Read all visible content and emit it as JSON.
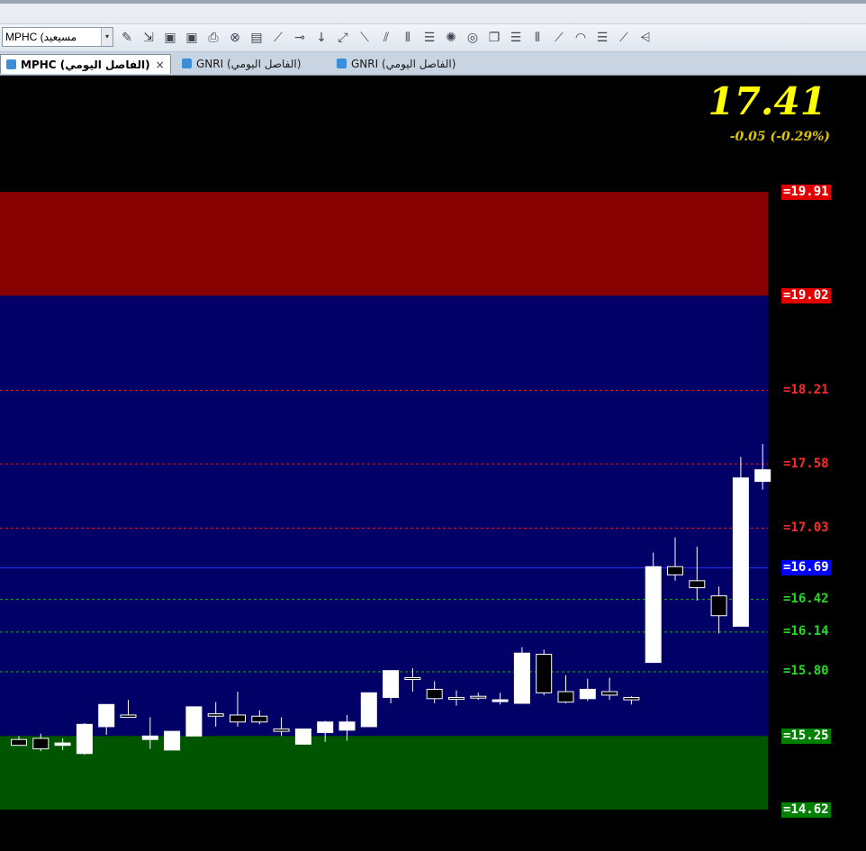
{
  "toolbar": {
    "symbol_value": "MPHC (مسيعيد",
    "dropdown_glyph": "▾",
    "icons": [
      "wand-icon",
      "import-icon",
      "new-chart-icon",
      "close-chart-icon",
      "print-icon",
      "delete-icon",
      "indicator-icon",
      "line-tool-icon",
      "horizontal-line-icon",
      "vertical-line-icon",
      "ray-icon",
      "channel-icon",
      "parallel-lines-icon",
      "vertical-lines-icon",
      "fib-retracement-icon",
      "marker-icon",
      "circle-tool-icon",
      "copy-icon",
      "fib-levels-icon",
      "cycle-lines-icon",
      "gann-angle-icon",
      "arc-icon",
      "fib-time-icon",
      "speed-lines-icon",
      "fib-fan-icon"
    ]
  },
  "tabs": [
    {
      "label": "MPHC (الفاصل اليومي)",
      "active": true,
      "close": "×"
    },
    {
      "label": "GNRI (الفاصل اليومي)",
      "active": false
    },
    {
      "label": "GNRI (الفاصل اليومي)",
      "active": false
    }
  ],
  "quote": {
    "price": "17.41",
    "change": "-0.05  (-0.29%)"
  },
  "levels": [
    {
      "label": "=19.91",
      "value": 19.91,
      "text_color": "#ffffff",
      "bg": "#e00000",
      "line": "none"
    },
    {
      "label": "=19.02",
      "value": 19.02,
      "text_color": "#ffffff",
      "bg": "#e00000",
      "line": "none"
    },
    {
      "label": "=18.21",
      "value": 18.21,
      "text_color": "#ff2a2a",
      "bg": "",
      "line": "#cc2222"
    },
    {
      "label": "=17.58",
      "value": 17.58,
      "text_color": "#ff2a2a",
      "bg": "",
      "line": "#cc2222"
    },
    {
      "label": "=17.03",
      "value": 17.03,
      "text_color": "#ff2a2a",
      "bg": "",
      "line": "#cc2222"
    },
    {
      "label": "=16.69",
      "value": 16.69,
      "text_color": "#ffffff",
      "bg": "#0000ff",
      "line": "#2233ff"
    },
    {
      "label": "=16.42",
      "value": 16.42,
      "text_color": "#22dd22",
      "bg": "",
      "line": "#22aa22"
    },
    {
      "label": "=16.14",
      "value": 16.14,
      "text_color": "#22dd22",
      "bg": "",
      "line": "#22aa22"
    },
    {
      "label": "=15.80",
      "value": 15.8,
      "text_color": "#22dd22",
      "bg": "",
      "line": "#22aa22"
    },
    {
      "label": "=15.25",
      "value": 15.25,
      "text_color": "#ffffff",
      "bg": "#008000",
      "line": "none"
    },
    {
      "label": "=14.62",
      "value": 14.62,
      "text_color": "#ffffff",
      "bg": "#008000",
      "line": "none"
    }
  ],
  "chart_data": {
    "type": "candlestick",
    "zones": [
      {
        "from": 19.02,
        "to": 19.91,
        "color": "#880000"
      },
      {
        "from": 15.25,
        "to": 19.02,
        "color": "#000066"
      },
      {
        "from": 14.62,
        "to": 15.25,
        "color": "#005500"
      }
    ],
    "candles": [
      {
        "o": 15.22,
        "h": 15.25,
        "l": 15.17,
        "c": 15.17
      },
      {
        "o": 15.23,
        "h": 15.27,
        "l": 15.12,
        "c": 15.14
      },
      {
        "o": 15.17,
        "h": 15.23,
        "l": 15.13,
        "c": 15.19
      },
      {
        "o": 15.1,
        "h": 15.36,
        "l": 15.09,
        "c": 15.35
      },
      {
        "o": 15.33,
        "h": 15.51,
        "l": 15.26,
        "c": 15.52
      },
      {
        "o": 15.43,
        "h": 15.56,
        "l": 15.42,
        "c": 15.41
      },
      {
        "o": 15.22,
        "h": 15.41,
        "l": 15.14,
        "c": 15.25
      },
      {
        "o": 15.13,
        "h": 15.28,
        "l": 15.13,
        "c": 15.29
      },
      {
        "o": 15.25,
        "h": 15.4,
        "l": 15.25,
        "c": 15.5
      },
      {
        "o": 15.44,
        "h": 15.54,
        "l": 15.33,
        "c": 15.42
      },
      {
        "o": 15.43,
        "h": 15.63,
        "l": 15.33,
        "c": 15.37
      },
      {
        "o": 15.42,
        "h": 15.47,
        "l": 15.35,
        "c": 15.37
      },
      {
        "o": 15.31,
        "h": 15.41,
        "l": 15.25,
        "c": 15.29
      },
      {
        "o": 15.18,
        "h": 15.31,
        "l": 15.18,
        "c": 15.31
      },
      {
        "o": 15.28,
        "h": 15.38,
        "l": 15.2,
        "c": 15.37
      },
      {
        "o": 15.3,
        "h": 15.43,
        "l": 15.21,
        "c": 15.37
      },
      {
        "o": 15.33,
        "h": 15.62,
        "l": 15.33,
        "c": 15.62
      },
      {
        "o": 15.58,
        "h": 15.81,
        "l": 15.53,
        "c": 15.81
      },
      {
        "o": 15.75,
        "h": 15.83,
        "l": 15.63,
        "c": 15.74
      },
      {
        "o": 15.65,
        "h": 15.72,
        "l": 15.53,
        "c": 15.57
      },
      {
        "o": 15.58,
        "h": 15.64,
        "l": 15.51,
        "c": 15.57
      },
      {
        "o": 15.59,
        "h": 15.62,
        "l": 15.56,
        "c": 15.58
      },
      {
        "o": 15.56,
        "h": 15.62,
        "l": 15.52,
        "c": 15.56
      },
      {
        "o": 15.53,
        "h": 16.01,
        "l": 15.53,
        "c": 15.96
      },
      {
        "o": 15.95,
        "h": 15.99,
        "l": 15.6,
        "c": 15.62
      },
      {
        "o": 15.63,
        "h": 15.77,
        "l": 15.53,
        "c": 15.54
      },
      {
        "o": 15.57,
        "h": 15.74,
        "l": 15.55,
        "c": 15.65
      },
      {
        "o": 15.63,
        "h": 15.75,
        "l": 15.56,
        "c": 15.6
      },
      {
        "o": 15.58,
        "h": 15.59,
        "l": 15.52,
        "c": 15.56
      },
      {
        "o": 15.88,
        "h": 16.82,
        "l": 15.88,
        "c": 16.7
      },
      {
        "o": 16.7,
        "h": 16.95,
        "l": 16.58,
        "c": 16.63
      },
      {
        "o": 16.58,
        "h": 16.87,
        "l": 16.41,
        "c": 16.52
      },
      {
        "o": 16.45,
        "h": 16.53,
        "l": 16.13,
        "c": 16.28
      },
      {
        "o": 16.19,
        "h": 17.64,
        "l": 16.19,
        "c": 17.46
      },
      {
        "o": 17.43,
        "h": 17.75,
        "l": 17.36,
        "c": 17.53
      }
    ]
  }
}
